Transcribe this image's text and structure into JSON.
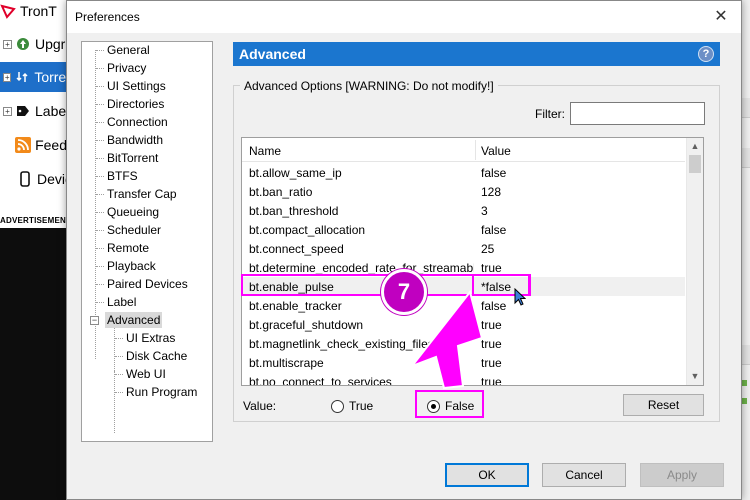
{
  "background_app": {
    "sidebar": [
      {
        "label": "TronT",
        "icon": "tron-logo-icon"
      },
      {
        "label": "Upgra",
        "icon": "upgrade-icon"
      },
      {
        "label": "Torren",
        "icon": "torrents-icon"
      },
      {
        "label": "Label",
        "icon": "label-icon"
      },
      {
        "label": "Feeds",
        "icon": "rss-icon"
      },
      {
        "label": "Devic",
        "icon": "device-icon"
      }
    ],
    "ad_label": "ADVERTISEMENT"
  },
  "dialog": {
    "title": "Preferences",
    "close": "✕"
  },
  "tree": {
    "items": [
      "General",
      "Privacy",
      "UI Settings",
      "Directories",
      "Connection",
      "Bandwidth",
      "BitTorrent",
      "BTFS",
      "Transfer Cap",
      "Queueing",
      "Scheduler",
      "Remote",
      "Playback",
      "Paired Devices",
      "Label",
      "Advanced"
    ],
    "expander": "−",
    "children": [
      "UI Extras",
      "Disk Cache",
      "Web UI",
      "Run Program"
    ],
    "selected": "Advanced"
  },
  "panel": {
    "header": "Advanced",
    "help": "?",
    "group_title": "Advanced Options [WARNING: Do not modify!]",
    "filter_label": "Filter:",
    "filter_value": ""
  },
  "list": {
    "columns": [
      "Name",
      "Value"
    ],
    "rows": [
      {
        "name": "bt.allow_same_ip",
        "value": "false"
      },
      {
        "name": "bt.ban_ratio",
        "value": "128"
      },
      {
        "name": "bt.ban_threshold",
        "value": "3"
      },
      {
        "name": "bt.compact_allocation",
        "value": "false"
      },
      {
        "name": "bt.connect_speed",
        "value": "25"
      },
      {
        "name": "bt.determine_encoded_rate_for_streamables",
        "value": "true"
      },
      {
        "name": "bt.enable_pulse",
        "value": "*false"
      },
      {
        "name": "bt.enable_tracker",
        "value": "false"
      },
      {
        "name": "bt.graceful_shutdown",
        "value": "true"
      },
      {
        "name": "bt.magnetlink_check_existing_files",
        "value": "true"
      },
      {
        "name": "bt.multiscrape",
        "value": "true"
      },
      {
        "name": "bt.no_connect_to_services",
        "value": "true"
      }
    ],
    "selected_row": "bt.enable_pulse",
    "scroll_up": "▲",
    "scroll_down": "▼"
  },
  "value_row": {
    "label": "Value:",
    "true_label": "True",
    "false_label": "False",
    "selected": "False",
    "reset": "Reset"
  },
  "footer": {
    "ok": "OK",
    "cancel": "Cancel",
    "apply": "Apply"
  },
  "annotation": {
    "step": "7",
    "color": "#ff00ff"
  },
  "colors": {
    "header_blue": "#1b76cf",
    "selection_blue": "#1e6fc9",
    "highlight_magenta": "#ff00ff"
  }
}
